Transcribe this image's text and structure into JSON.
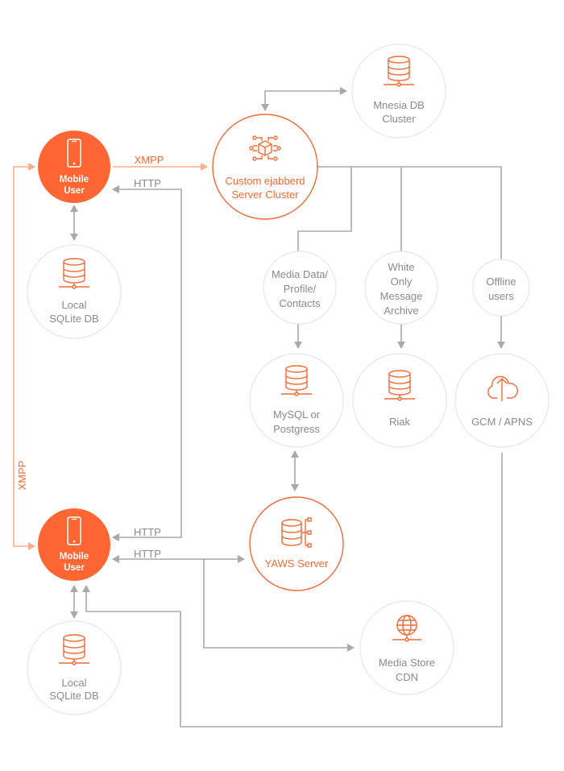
{
  "colors": {
    "accent": "#f26a35",
    "line": "#a9a9a9",
    "xmpp_line": "#ffae85",
    "node_border": "#e6e6e6",
    "label": "#8a8a8a"
  },
  "nodes": {
    "mobile_user_top": {
      "line1": "Mobile",
      "line2": "User",
      "icon": "smartphone-icon"
    },
    "sqlite_top": {
      "line1": "Local",
      "line2": "SQLite DB",
      "icon": "database-icon"
    },
    "ejabberd": {
      "line1": "Custom ejabberd",
      "line2": "Server Cluster",
      "icon": "network-cube-icon"
    },
    "mnesia": {
      "line1": "Mnesia DB",
      "line2": "Cluster",
      "icon": "database-icon"
    },
    "media_data": {
      "line1": "Media Data/",
      "line2": "Profile/",
      "line3": "Contacts"
    },
    "white_only": {
      "line1": "White",
      "line2": "Only",
      "line3": "Message",
      "line4": "Archive"
    },
    "offline": {
      "line1": "Offline",
      "line2": "users"
    },
    "mysql": {
      "line1": "MySQL or",
      "line2": "Postgress",
      "icon": "database-icon"
    },
    "riak": {
      "line1": "Riak",
      "icon": "database-icon"
    },
    "gcm": {
      "line1": "GCM / APNS",
      "icon": "cloud-upload-icon"
    },
    "yaws": {
      "line1": "YAWS Server",
      "icon": "database-server-icon"
    },
    "mobile_user_bottom": {
      "line1": "Mobile",
      "line2": "User",
      "icon": "smartphone-icon"
    },
    "sqlite_bottom": {
      "line1": "Local",
      "line2": "SQLite DB",
      "icon": "database-icon"
    },
    "cdn": {
      "line1": "Media Store",
      "line2": "CDN",
      "icon": "globe-icon"
    }
  },
  "edges": {
    "xmpp_top": "XMPP",
    "http_top": "HTTP",
    "xmpp_side": "XMPP",
    "http_bottom_1": "HTTP",
    "http_bottom_2": "HTTP"
  }
}
